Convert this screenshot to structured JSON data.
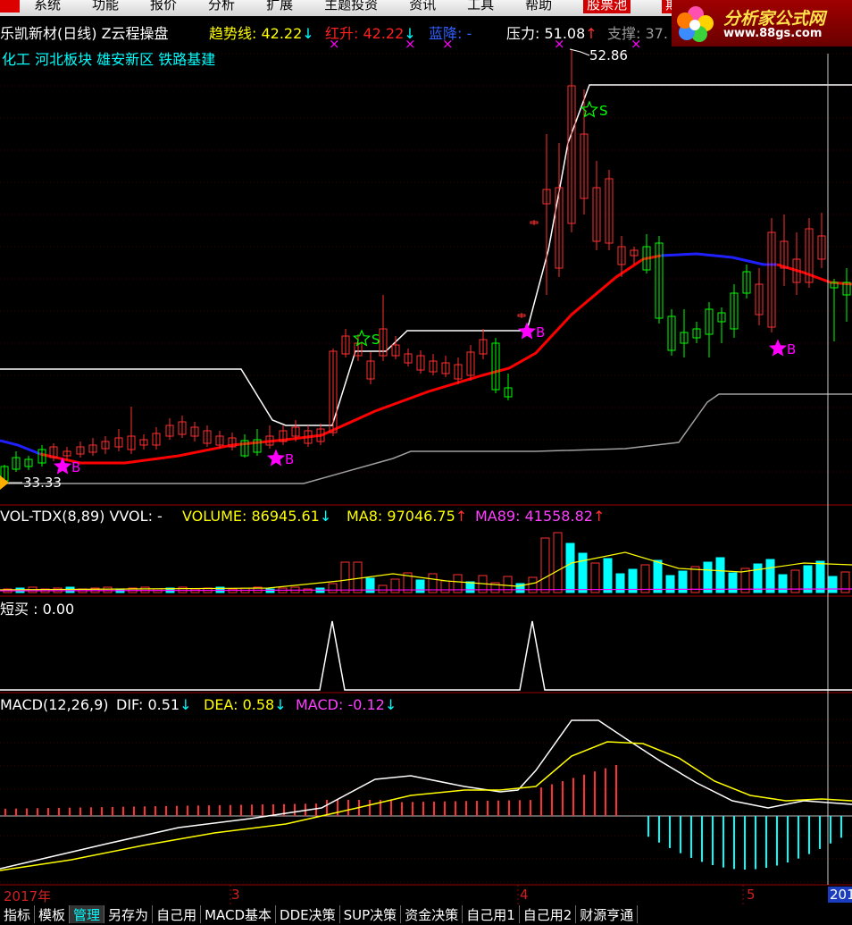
{
  "menu": [
    "系统",
    "功能",
    "报价",
    "分析",
    "扩展",
    "主题投资",
    "资讯",
    "工具",
    "帮助",
    "股票池",
    "期"
  ],
  "brand": {
    "title": "分析家公式网",
    "url": "www.88gs.com"
  },
  "header": {
    "stock": "乐凯新材(日线) Z云程操盘",
    "trend_label": "趋势线: 42.22",
    "trend_arrow": "↓",
    "red_label": "红升: 42.22",
    "red_arrow": "↓",
    "blue_label": "蓝降: -",
    "pressure_label": "压力: 51.08",
    "pressure_arrow": "↑",
    "support_label": "支撑: 37.",
    "sectors": "化工 河北板块 雄安新区 铁路基建"
  },
  "price_chart": {
    "high_label": "52.86",
    "low_label": "33.33",
    "buy_marker": "B",
    "sell_marker": "S",
    "colors": {
      "up": "#ff3030",
      "down": "#00ff00",
      "red_line": "#ff0000",
      "blue_line": "#2020ff",
      "white_line": "#ffffff",
      "gray_line": "#a0a0a0",
      "magenta": "#ff00ff"
    }
  },
  "vol_panel": {
    "name": "VOL-TDX(8,89) VVOL: -",
    "volume_label": "VOLUME: 86945.61",
    "volume_arrow": "↓",
    "ma8_label": "MA8: 97046.75",
    "ma8_arrow": "↑",
    "ma89_label": "MA89: 41558.82",
    "ma89_arrow": "↑"
  },
  "short_panel": {
    "label": "短买 : 0.00"
  },
  "macd_panel": {
    "name": "MACD(12,26,9)",
    "dif_label": "DIF: 0.51",
    "dif_arrow": "↓",
    "dea_label": "DEA: 0.58",
    "dea_arrow": "↓",
    "macd_label": "MACD: -0.12",
    "macd_arrow": "↓"
  },
  "x_axis": {
    "year_label": "2017年",
    "m3": "3",
    "m4": "4",
    "m5": "5",
    "end": "201"
  },
  "tabs": [
    "指标",
    "模板",
    "管理",
    "另存为",
    "自己用",
    "MACD基本",
    "DDE决策",
    "SUP决策",
    "资金决策",
    "自己用1",
    "自己用2",
    "财源亨通"
  ],
  "active_tab": "管理"
}
